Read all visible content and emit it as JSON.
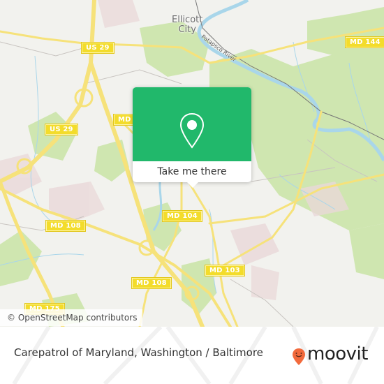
{
  "map": {
    "place_labels": [
      {
        "name": "ellicott-city-label",
        "lines": [
          "Ellicott",
          "City"
        ]
      }
    ],
    "river_label": "Patapsco River",
    "road_shields": [
      {
        "id": "us29-north",
        "label": "US 29"
      },
      {
        "id": "md144",
        "label": "MD 144"
      },
      {
        "id": "md-partial",
        "label": "MD"
      },
      {
        "id": "us29-south",
        "label": "US 29"
      },
      {
        "id": "md108-west",
        "label": "MD 108"
      },
      {
        "id": "md104",
        "label": "MD 104"
      },
      {
        "id": "md103",
        "label": "MD 103"
      },
      {
        "id": "md108-center",
        "label": "MD 108"
      },
      {
        "id": "md175",
        "label": "MD 175"
      },
      {
        "id": "md108-south",
        "label": "MD 108"
      }
    ],
    "attribution": "© OpenStreetMap contributors",
    "colors": {
      "background": "#f2f2ee",
      "park": "#cfe6b0",
      "water": "#a9d6ea",
      "road": "#f6e27a",
      "urban": "#ead9d9"
    }
  },
  "popup": {
    "icon": "map-pin-icon",
    "button_label": "Take me there",
    "accent": "#21b86b"
  },
  "footer": {
    "title": "Carepatrol of Maryland, Washington / Baltimore",
    "brand": "moovit",
    "brand_color": "#f26a3c"
  }
}
